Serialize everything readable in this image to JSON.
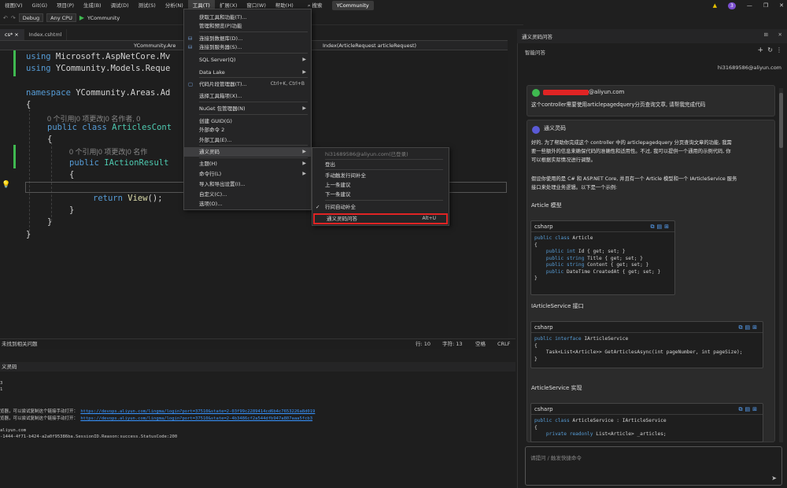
{
  "menubar": {
    "items": [
      "视图(V)",
      "Git(G)",
      "项目(P)",
      "生成(B)",
      "调试(D)",
      "测试(S)",
      "分析(N)",
      "工具(T)",
      "扩展(X)",
      "窗口(W)",
      "帮助(H)"
    ],
    "search": "搜索",
    "brand": "YCommunity",
    "notification_count": "3"
  },
  "toolbar": {
    "config": "Debug",
    "platform": "Any CPU",
    "run_label": "YCommunity"
  },
  "tabs": [
    "cs* ×",
    "Index.cshtml"
  ],
  "navbar": {
    "class_path": "YCommunity.Are",
    "method": "Index(ArticleRequest articleRequest)"
  },
  "code": {
    "l1_kw": "using",
    "l1_ns": " Microsoft.AspNetCore.Mv",
    "l2_kw": "using",
    "l2_ns": " YCommunity.Models.Reque",
    "l3_kw": "namespace",
    "l3_ns": " YCommunity.Areas.Ad",
    "l4": "{",
    "lens1": "0 个引用|0 项更改|0 名作者, 0",
    "l5_kw": "public class",
    "l5_tp": " ArticlesCont",
    "l6": "{",
    "lens2": "0 个引用|0 项更改|0 名作",
    "l7_kw": "public",
    "l7_tp": " IActionResult",
    "l8": "{",
    "l9_kw": "return",
    "l9_fn": " View",
    "l9_rest": "();",
    "l10": "}",
    "l11": "}",
    "l12": "}"
  },
  "tools_menu": {
    "items": [
      {
        "label": "获取工具和功能(T)...",
        "shortcut": "",
        "submenu": false
      },
      {
        "label": "管理和预览(P)功能",
        "shortcut": "",
        "submenu": false
      },
      {
        "label": "连接到数据库(D)...",
        "shortcut": "",
        "submenu": false
      },
      {
        "label": "连接到服务器(S)...",
        "shortcut": "",
        "submenu": false
      },
      {
        "label": "SQL Server(Q)",
        "shortcut": "",
        "submenu": true
      },
      {
        "label": "Data Lake",
        "shortcut": "",
        "submenu": true
      },
      {
        "label": "代码片段管理器(T)...",
        "shortcut": "Ctrl+K, Ctrl+B",
        "submenu": false
      },
      {
        "label": "选择工具箱项(X)...",
        "shortcut": "",
        "submenu": false
      },
      {
        "label": "NuGet 包管理器(N)",
        "shortcut": "",
        "submenu": true
      },
      {
        "label": "创建 GUID(G)",
        "shortcut": "",
        "submenu": false
      },
      {
        "label": "外部命令 2",
        "shortcut": "",
        "submenu": false
      },
      {
        "label": "外部工具(E)...",
        "shortcut": "",
        "submenu": false
      },
      {
        "label": "通义灵码",
        "shortcut": "",
        "submenu": true
      },
      {
        "label": "主题(H)",
        "shortcut": "",
        "submenu": true
      },
      {
        "label": "命令行(L)",
        "shortcut": "",
        "submenu": true
      },
      {
        "label": "导入和导出设置(I)...",
        "shortcut": "",
        "submenu": false
      },
      {
        "label": "自定义(C)...",
        "shortcut": "",
        "submenu": false
      },
      {
        "label": "选项(O)...",
        "shortcut": "",
        "submenu": false
      }
    ]
  },
  "lingma_submenu": {
    "account": "hi31689586@aliyun.com(已登录)",
    "logout": "登出",
    "trigger": "手动触发行间补全",
    "prev": "上一条建议",
    "next": "下一条建议",
    "auto": "行间自动补全",
    "open_chat": "通义灵码问答",
    "open_chat_shortcut": "Alt+U"
  },
  "editor_status": {
    "left": "未找到相关问题",
    "line": "行: 10",
    "char": "字符: 13",
    "space": "空格",
    "eol": "CRLF"
  },
  "output": {
    "title": "义灵码",
    "lines": [
      "3",
      "1"
    ],
    "link_prefix": "览器，可以尝试复制这个链接手动打开：",
    "link1": "https://devops.aliyun.com/lingma/login?port=37510&state=2-03f99c2289414cd6b4c7653226a8d019",
    "link2": "https://devops.aliyun.com/lingma/login?port=37510&state=2-4b3486cf2a544dfb947a807aaa5fcb3",
    "line_email": "aliyun.com",
    "line_status": "-1444-4f71-b424-a2a0f95386ba.SessionID.Reason:success.StatusCode:200"
  },
  "chat": {
    "title": "通义灵码问答",
    "subtitle": "智能问答",
    "user_email": "hi31689586@aliyun.com",
    "q_email_suffix": "@aliyun.com",
    "question": "这个controller需要使用articlepagedquery分页查询文章, 请帮我完成代码",
    "bot_name": "通义灵码",
    "p1": "好的, 为了帮助你完成这个 controller 中的 articlepagedquery 分页查询文章的功能, 我需",
    "p2": "要一些额外的信息来确保代码的准确性和适用性。不过, 我可以提供一个通用的示例代码, 你",
    "p3": "可以根据实际情况进行调整。",
    "p4": "假设你使用的是 C# 和 ASP.NET Core, 并且有一个 Article 模型和一个 IArticleService 服务",
    "p5": "接口来处理业务逻辑。以下是一个示例:",
    "h1": "Article 模型",
    "h2": "IArticleService 接口",
    "h3": "ArticleService 实现",
    "lang": "csharp",
    "code1": [
      {
        "k": "public class",
        "r": " Article"
      },
      {
        "k": "",
        "r": "{"
      },
      {
        "k": "    public int",
        "r": " Id { get; set; }"
      },
      {
        "k": "    public string",
        "r": " Title { get; set; }"
      },
      {
        "k": "    public string",
        "r": " Content { get; set; }"
      },
      {
        "k": "    public",
        "r": " DateTime CreatedAt { get; set; }"
      },
      {
        "k": "",
        "r": "}"
      }
    ],
    "code2": [
      {
        "k": "public interface",
        "r": " IArticleService"
      },
      {
        "k": "",
        "r": "{"
      },
      {
        "k": "",
        "r": "    Task<List<Article>> GetArticlesAsync(int pageNumber, int pageSize);"
      },
      {
        "k": "",
        "r": "}"
      }
    ],
    "code3": [
      {
        "k": "public class",
        "r": " ArticleService : IArticleService"
      },
      {
        "k": "",
        "r": "{"
      },
      {
        "k": "    private readonly",
        "r": " List<Article> _articles;"
      }
    ],
    "input_placeholder": "请提问 / 触发快捷命令"
  },
  "colors": {
    "accent": "#7b4fd1",
    "keyword": "#569cd6",
    "type": "#4ec9b0",
    "highlight_box": "#e02424"
  }
}
